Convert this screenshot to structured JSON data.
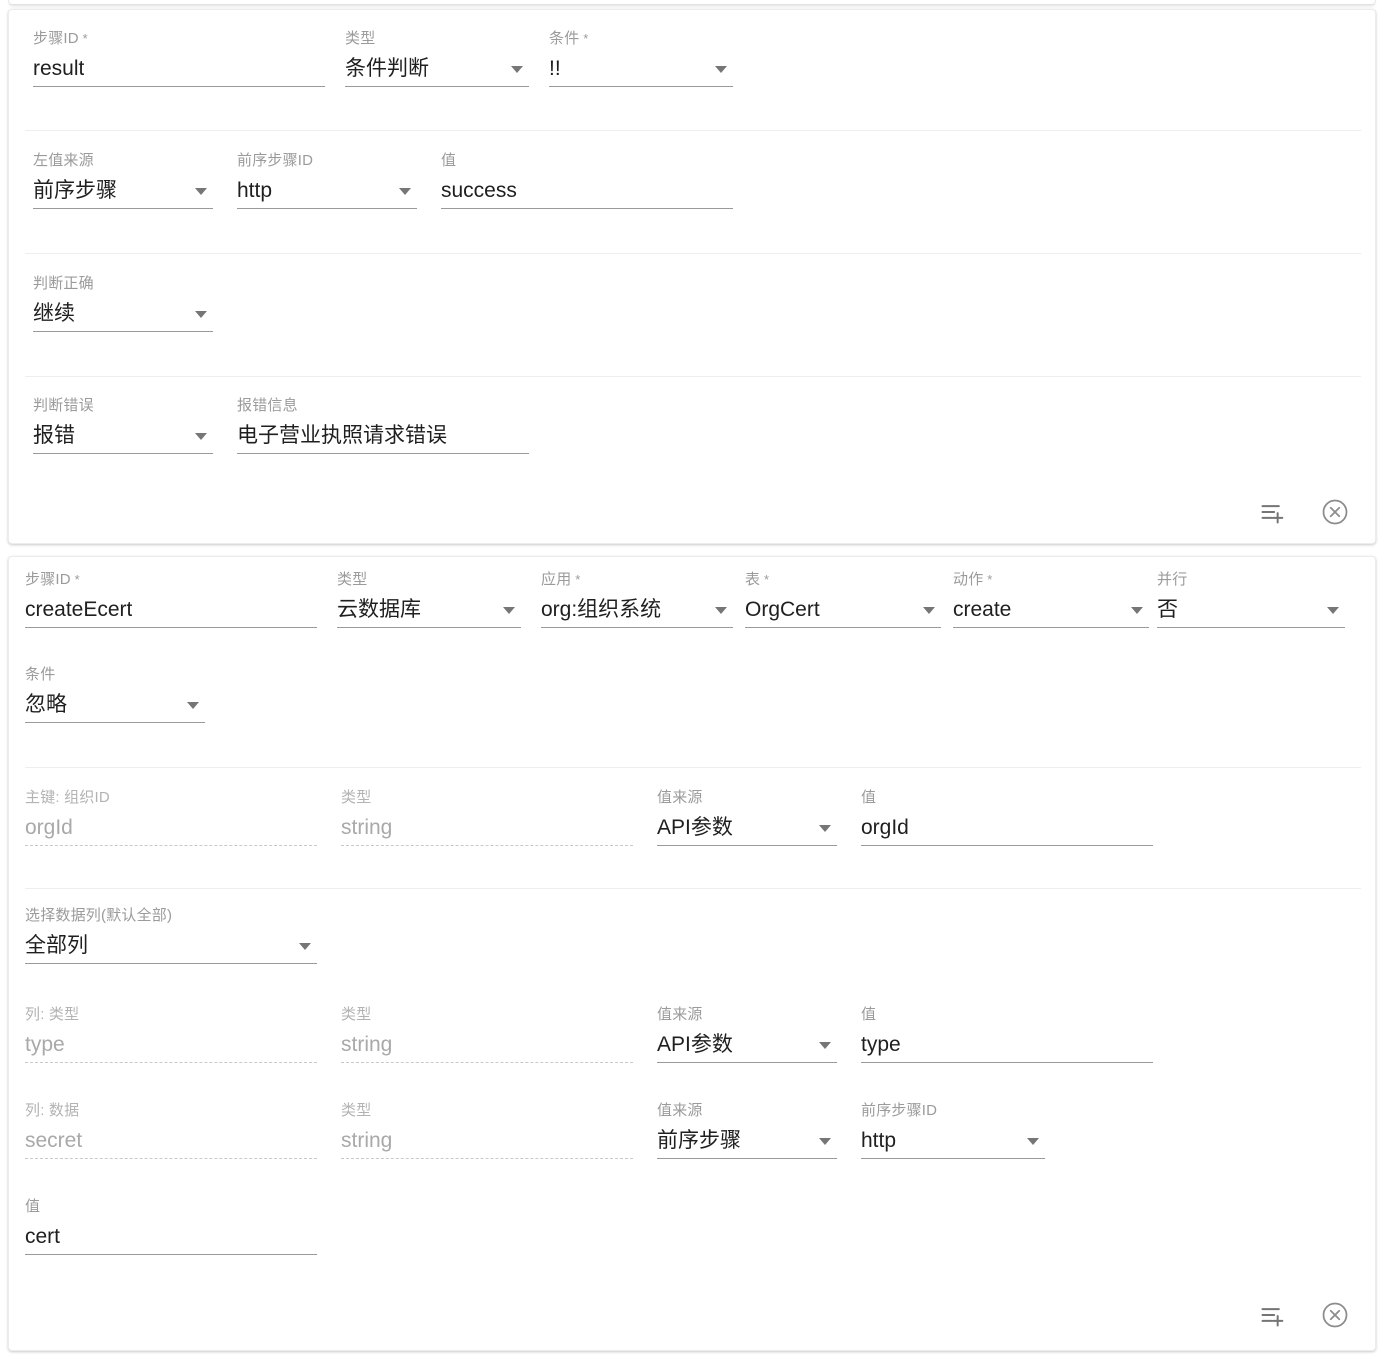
{
  "cards": [
    {
      "id": "condition-step",
      "rows": [
        {
          "fields": [
            {
              "label": "步骤ID",
              "required": true,
              "value": "result",
              "control": "text",
              "disabled": false
            },
            {
              "label": "类型",
              "required": false,
              "value": "条件判断",
              "control": "select",
              "disabled": false
            },
            {
              "label": "条件",
              "required": true,
              "value": "!!",
              "control": "select",
              "disabled": false
            }
          ]
        },
        {
          "fields": [
            {
              "label": "左值来源",
              "required": false,
              "value": "前序步骤",
              "control": "select",
              "disabled": false
            },
            {
              "label": "前序步骤ID",
              "required": false,
              "value": "http",
              "control": "select",
              "disabled": false
            },
            {
              "label": "值",
              "required": false,
              "value": "success",
              "control": "text",
              "disabled": false
            }
          ]
        },
        {
          "fields": [
            {
              "label": "判断正确",
              "required": false,
              "value": "继续",
              "control": "select",
              "disabled": false
            }
          ]
        },
        {
          "fields": [
            {
              "label": "判断错误",
              "required": false,
              "value": "报错",
              "control": "select",
              "disabled": false
            },
            {
              "label": "报错信息",
              "required": false,
              "value": "电子营业执照请求错误",
              "control": "text",
              "disabled": false
            }
          ]
        }
      ],
      "actions": [
        {
          "name": "add-step-icon",
          "title": "新增"
        },
        {
          "name": "remove-step-icon",
          "title": "删除"
        }
      ]
    },
    {
      "id": "cloud-db-step",
      "rows": [
        {
          "fields": [
            {
              "label": "步骤ID",
              "required": true,
              "value": "createEcert",
              "control": "text",
              "disabled": false
            },
            {
              "label": "类型",
              "required": false,
              "value": "云数据库",
              "control": "select",
              "disabled": false
            },
            {
              "label": "应用",
              "required": true,
              "value": "org:组织系统",
              "control": "select",
              "disabled": false
            },
            {
              "label": "表",
              "required": true,
              "value": "OrgCert",
              "control": "select",
              "disabled": false
            },
            {
              "label": "动作",
              "required": true,
              "value": "create",
              "control": "select",
              "disabled": false
            },
            {
              "label": "并行",
              "required": false,
              "value": "否",
              "control": "select",
              "disabled": false
            }
          ]
        },
        {
          "fields": [
            {
              "label": "条件",
              "required": false,
              "value": "忽略",
              "control": "select",
              "disabled": false
            }
          ]
        },
        {
          "fields": [
            {
              "label": "主键: 组织ID",
              "required": false,
              "value": "orgId",
              "control": "text",
              "disabled": true
            },
            {
              "label": "类型",
              "required": false,
              "value": "string",
              "control": "text",
              "disabled": true
            },
            {
              "label": "值来源",
              "required": false,
              "value": "API参数",
              "control": "select",
              "disabled": false
            },
            {
              "label": "值",
              "required": false,
              "value": "orgId",
              "control": "text",
              "disabled": false
            }
          ]
        },
        {
          "fields": [
            {
              "label": "选择数据列(默认全部)",
              "required": false,
              "value": "全部列",
              "control": "select",
              "disabled": false
            }
          ]
        },
        {
          "fields": [
            {
              "label": "列: 类型",
              "required": false,
              "value": "type",
              "control": "text",
              "disabled": true
            },
            {
              "label": "类型",
              "required": false,
              "value": "string",
              "control": "text",
              "disabled": true
            },
            {
              "label": "值来源",
              "required": false,
              "value": "API参数",
              "control": "select",
              "disabled": false
            },
            {
              "label": "值",
              "required": false,
              "value": "type",
              "control": "text",
              "disabled": false
            }
          ]
        },
        {
          "fields": [
            {
              "label": "列: 数据",
              "required": false,
              "value": "secret",
              "control": "text",
              "disabled": true
            },
            {
              "label": "类型",
              "required": false,
              "value": "string",
              "control": "text",
              "disabled": true
            },
            {
              "label": "值来源",
              "required": false,
              "value": "前序步骤",
              "control": "select",
              "disabled": false
            },
            {
              "label": "前序步骤ID",
              "required": false,
              "value": "http",
              "control": "select",
              "disabled": false
            }
          ]
        },
        {
          "fields": [
            {
              "label": "值",
              "required": false,
              "value": "cert",
              "control": "text",
              "disabled": false
            }
          ]
        }
      ],
      "actions": [
        {
          "name": "add-step-icon",
          "title": "新增"
        },
        {
          "name": "remove-step-icon",
          "title": "删除"
        }
      ]
    }
  ],
  "colors": {
    "label": "#9b9b9b",
    "value": "#1f1f1f",
    "disabled_value": "#a9a9a9",
    "underline": "#9a9a9a",
    "divider": "#eeeeee",
    "card_bg": "#ffffff"
  }
}
